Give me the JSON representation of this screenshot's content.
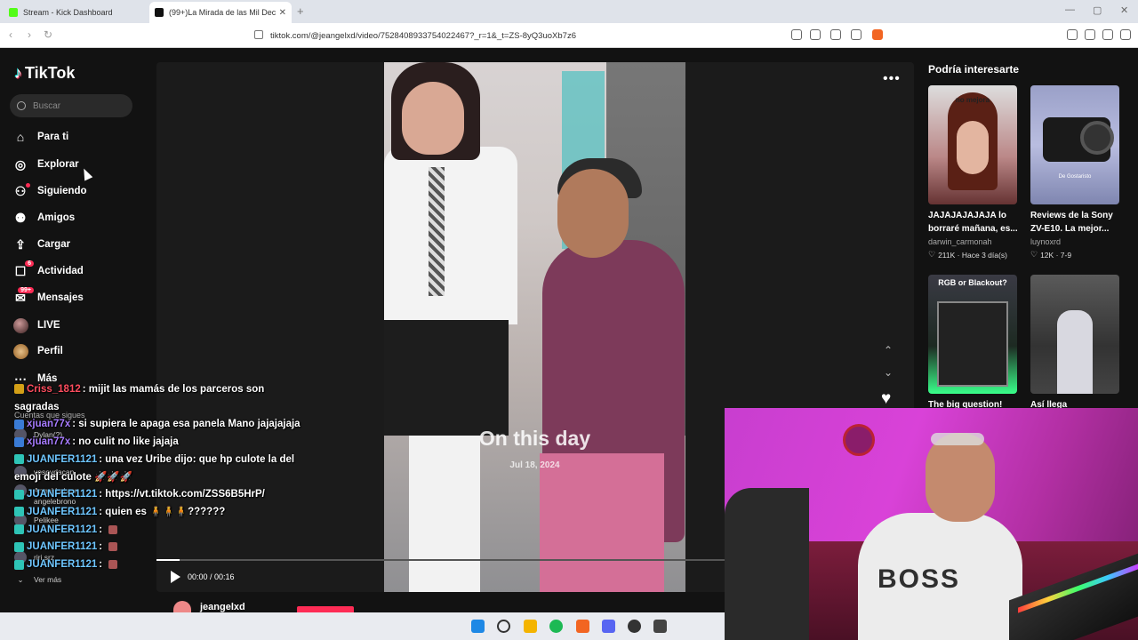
{
  "browser": {
    "tabs": [
      {
        "title": "Stream - Kick Dashboard",
        "favicon_color": "#53fc18"
      },
      {
        "title": "(99+)La Mirada de las Mil Decep",
        "favicon_color": "#111111"
      }
    ],
    "url": "tiktok.com/@jeangelxd/video/7528408933754022467?_r=1&_t=ZS-8yQ3uoXb7z6"
  },
  "tiktok": {
    "logo": "TikTok",
    "search_placeholder": "Buscar",
    "nav": [
      {
        "label": "Para ti",
        "icon": "home-icon"
      },
      {
        "label": "Explorar",
        "icon": "compass-icon"
      },
      {
        "label": "Siguiendo",
        "icon": "following-icon"
      },
      {
        "label": "Amigos",
        "icon": "friends-icon"
      },
      {
        "label": "Cargar",
        "icon": "upload-icon"
      },
      {
        "label": "Actividad",
        "icon": "activity-icon",
        "badge": "6"
      },
      {
        "label": "Mensajes",
        "icon": "messages-icon",
        "badge": "99+"
      },
      {
        "label": "LIVE",
        "icon": "live-icon"
      },
      {
        "label": "Perfil",
        "icon": "profile-icon"
      },
      {
        "label": "Más",
        "icon": "more-icon"
      }
    ],
    "following_title": "Cuentas que sigues",
    "following": [
      "Dylan(?)",
      "vosoydacan",
      "Angel Lebron",
      "angelebrono",
      "Pelikee",
      "riri.srz"
    ],
    "see_more": "Ver más"
  },
  "video": {
    "overlay_title": "On this day",
    "overlay_date": "Jul 18, 2024",
    "time": "00:00 / 00:16",
    "progress": 0.04,
    "creator": "jeangelxd"
  },
  "rail": {
    "title": "Podría interesarte",
    "cards": [
      {
        "caption": "JAJAJAJAJAJA lo borraré mañana, es...",
        "author": "darwin_carmonah",
        "likes": "211K",
        "age": "Hace 3 día(s)",
        "thumb_text": "no mejora"
      },
      {
        "caption": "Reviews de la Sony ZV-E10. La mejor...",
        "author": "luynoxrd",
        "likes": "12K",
        "age": "7-9",
        "thumb_text": "De Gostaristo"
      },
      {
        "caption": "The big question!",
        "author": "",
        "likes": "",
        "age": "",
        "thumb_text": "RGB or Blackout?"
      },
      {
        "caption": "Así llega",
        "author": "",
        "likes": "",
        "age": "",
        "thumb_text": ""
      }
    ]
  },
  "chat": [
    {
      "user": "Criss_1812",
      "msg": "mijit las mamás de los parceros son sagradas",
      "color": "#ff4d5e",
      "badge": "#d4a017"
    },
    {
      "user": "xjuan77x",
      "msg": "si supiera le apaga esa panela Mano jajajajaja",
      "color": "#a77bff",
      "badge": "#3a7bd5"
    },
    {
      "user": "xjuan77x",
      "msg": "no culit no like jajaja",
      "color": "#a77bff",
      "badge": "#3a7bd5"
    },
    {
      "user": "JUANFER1121",
      "msg": "una vez Uribe dijo: que hp culote la del emoji del culote 🚀🚀🚀",
      "color": "#6ec6ff",
      "badge": "#2ec4b6"
    },
    {
      "user": "JUANFER1121",
      "msg": "https://vt.tiktok.com/ZSS6B5HrP/",
      "color": "#6ec6ff",
      "badge": "#2ec4b6"
    },
    {
      "user": "JUANFER1121",
      "msg": "quien es 🧍🧍🧍??????",
      "color": "#6ec6ff",
      "badge": "#2ec4b6"
    },
    {
      "user": "JUANFER1121",
      "msg": "",
      "color": "#6ec6ff",
      "badge": "#2ec4b6"
    },
    {
      "user": "JUANFER1121",
      "msg": "",
      "color": "#6ec6ff",
      "badge": "#2ec4b6"
    },
    {
      "user": "JUANFER1121",
      "msg": "",
      "color": "#6ec6ff",
      "badge": "#2ec4b6"
    }
  ],
  "webcam": {
    "shirt_text": "BOSS"
  }
}
